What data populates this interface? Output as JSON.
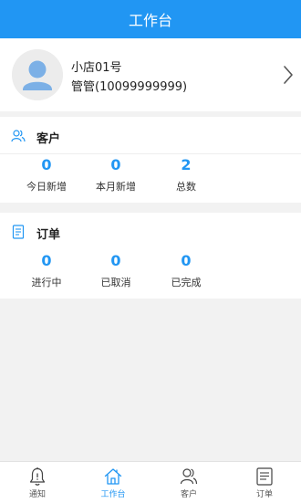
{
  "header": {
    "title": "工作台"
  },
  "profile": {
    "store_name": "小店01号",
    "account": "管管(10099999999)",
    "avatar_icon": "user-avatar-icon",
    "chevron_icon": "chevron-right-icon"
  },
  "customer_section": {
    "title": "客户",
    "icon": "users-icon",
    "stats": [
      {
        "value": "0",
        "label": "今日新增"
      },
      {
        "value": "0",
        "label": "本月新增"
      },
      {
        "value": "2",
        "label": "总数"
      }
    ]
  },
  "order_section": {
    "title": "订单",
    "icon": "document-icon",
    "stats": [
      {
        "value": "0",
        "label": "进行中"
      },
      {
        "value": "0",
        "label": "已取消"
      },
      {
        "value": "0",
        "label": "已完成"
      }
    ]
  },
  "tabbar": {
    "items": [
      {
        "label": "通知",
        "icon": "bell-icon",
        "active": false
      },
      {
        "label": "工作台",
        "icon": "home-icon",
        "active": true
      },
      {
        "label": "客户",
        "icon": "users-icon",
        "active": false
      },
      {
        "label": "订单",
        "icon": "document-icon",
        "active": false
      }
    ]
  },
  "colors": {
    "primary": "#2196f3",
    "background": "#f2f2f2",
    "card": "#ffffff",
    "text": "#222222"
  }
}
